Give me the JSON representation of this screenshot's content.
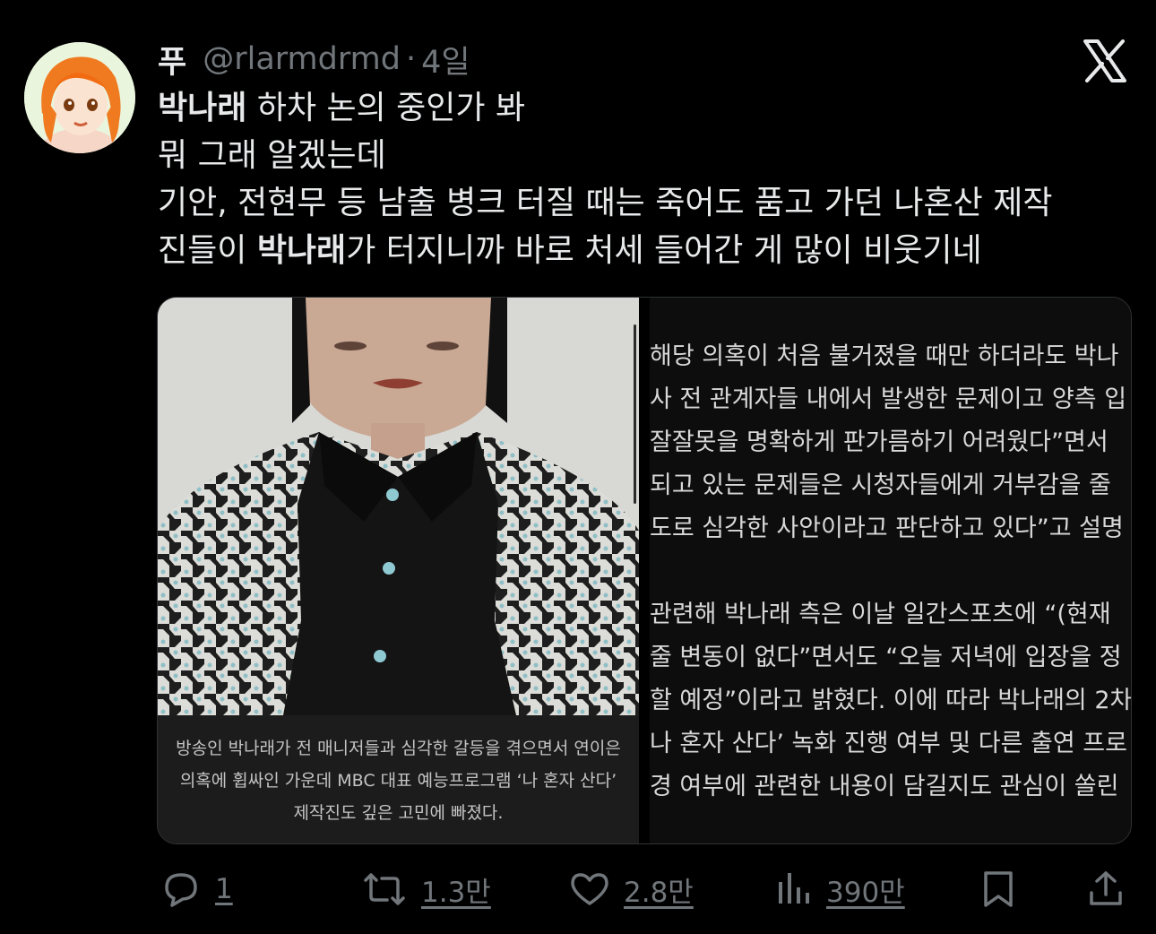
{
  "tweet": {
    "author": {
      "display_name": "푸",
      "handle": "@rlarmdrmd",
      "separator": "·",
      "time": "4일"
    },
    "text_lines": [
      {
        "parts": [
          {
            "bold": "박나래"
          },
          {
            "plain": " 하차 논의 중인가 봐"
          }
        ]
      },
      {
        "parts": [
          {
            "plain": "뭐 그래 알겠는데"
          }
        ]
      },
      {
        "parts": [
          {
            "plain": "기안, 전현무 등 남출 병크 터질 때는 죽어도 품고 가던 나혼산 제작"
          }
        ]
      },
      {
        "parts": [
          {
            "plain": "진들이 "
          },
          {
            "bold": "박나래"
          },
          {
            "plain": "가 터지니까 바로 처세 들어간 게 많이 비웃기네"
          }
        ]
      }
    ],
    "media": {
      "photo_caption": "방송인 박나래가 전 매니저들과 심각한 갈등을 겪으면서 연이은 의혹에 휩싸인 가운데 MBC 대표 예능프로그램 ‘나 혼자 산다’ 제작진도 깊은 고민에 빠졌다.",
      "article_lines": [
        "해당 의혹이 처음 불거졌을 때만 하더라도 박나",
        "사 전 관계자들 내에서 발생한 문제이고 양측 입",
        "잘잘못을 명확하게 판가름하기 어려웠다”면서",
        "되고 있는 문제들은 시청자들에게 거부감을 줄",
        "도로 심각한 사안이라고 판단하고 있다”고 설명",
        "",
        "관련해 박나래 측은 이날 일간스포츠에 “(현재",
        "줄 변동이 없다”면서도 “오늘 저녁에 입장을 정",
        "할 예정”이라고 밝혔다. 이에 따라 박나래의 2차",
        "나 혼자 산다’ 녹화 진행 여부 및 다른 출연 프로",
        "경 여부에 관련한 내용이 담길지도 관심이 쏠린"
      ]
    },
    "actions": {
      "reply": {
        "icon": "reply-icon",
        "count": "1"
      },
      "retweet": {
        "icon": "retweet-icon",
        "count": "1.3만"
      },
      "like": {
        "icon": "heart-icon",
        "count": "2.8만"
      },
      "views": {
        "icon": "views-icon",
        "count": "390만"
      },
      "bookmark": {
        "icon": "bookmark-icon"
      },
      "share": {
        "icon": "share-icon"
      }
    }
  },
  "colors": {
    "background": "#000000",
    "text": "#e7e9ea",
    "muted": "#71767b"
  }
}
